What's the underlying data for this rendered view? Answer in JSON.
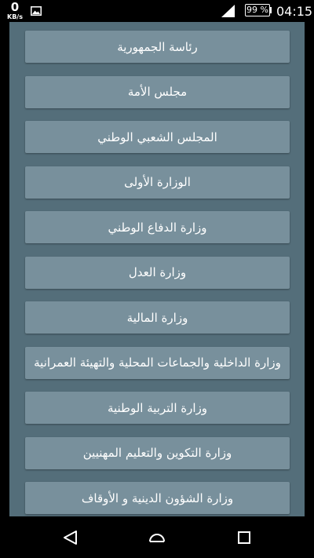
{
  "status_bar": {
    "speed_value": "0",
    "speed_unit": "KB/s",
    "battery": "99 %",
    "time": "04:15",
    "icons": [
      "image-notification-icon",
      "signal-icon",
      "battery-icon"
    ]
  },
  "menu": {
    "items": [
      "رئاسة الجمهورية",
      "مجلس الأمة",
      "المجلس الشعبي الوطني",
      "الوزارة الأولى",
      "وزارة الدفاع الوطني",
      "وزارة العدل",
      "وزارة المالية",
      "وزارة الداخلية والجماعات المحلية والتهيئة العمرانية",
      "وزارة التربية الوطنية",
      "وزارة التكوين والتعليم المهنيين",
      "وزارة الشؤون الدينية و الأوقاف"
    ]
  },
  "navigation_bar": {
    "icons": [
      "back-icon",
      "home-icon",
      "recents-icon"
    ]
  },
  "colors": {
    "panel": "#546e7a",
    "button": "#78909c",
    "text": "#ffffff",
    "bars": "#000000"
  }
}
